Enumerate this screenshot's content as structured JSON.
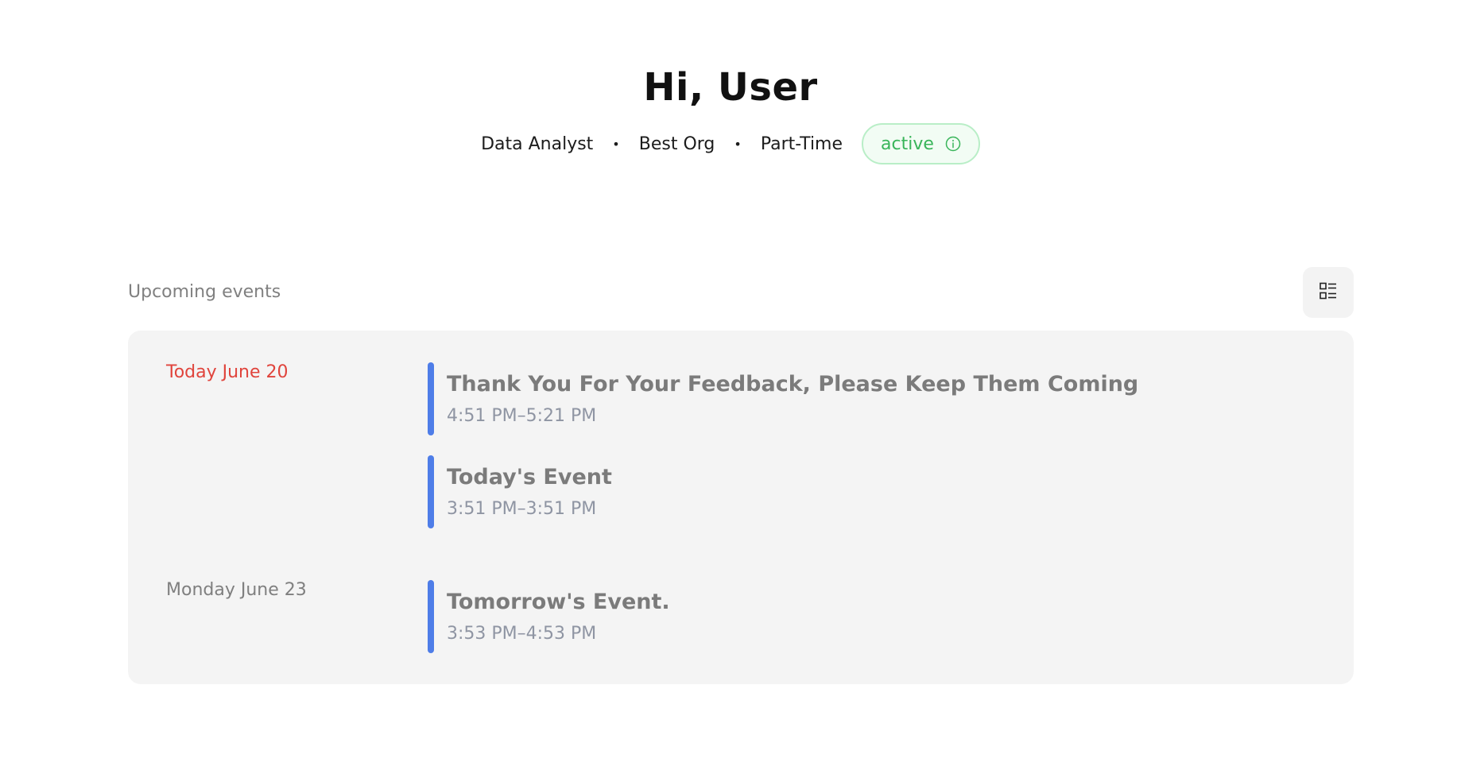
{
  "header": {
    "greeting": "Hi, User",
    "role": "Data Analyst",
    "organization": "Best Org",
    "employment_type": "Part-Time",
    "separator": "•",
    "status": "active",
    "status_icon": "info-circle-icon"
  },
  "upcoming": {
    "title": "Upcoming events",
    "view_toggle_icon": "list-view-icon",
    "groups": [
      {
        "date": "Today June 20",
        "is_today": true,
        "events": [
          {
            "title": "Thank You For Your Feedback, Please Keep Them Coming",
            "time": "4:51 PM–5:21 PM"
          },
          {
            "title": "Today's Event",
            "time": "3:51 PM–3:51 PM"
          }
        ]
      },
      {
        "date": "Monday June 23",
        "is_today": false,
        "events": [
          {
            "title": "Tomorrow's Event.",
            "time": "3:53 PM–4:53 PM"
          }
        ]
      }
    ]
  },
  "colors": {
    "today_date": "#e0443c",
    "status_green": "#39b55a",
    "event_bar": "#4e7de8",
    "card_bg": "#f4f4f4"
  }
}
